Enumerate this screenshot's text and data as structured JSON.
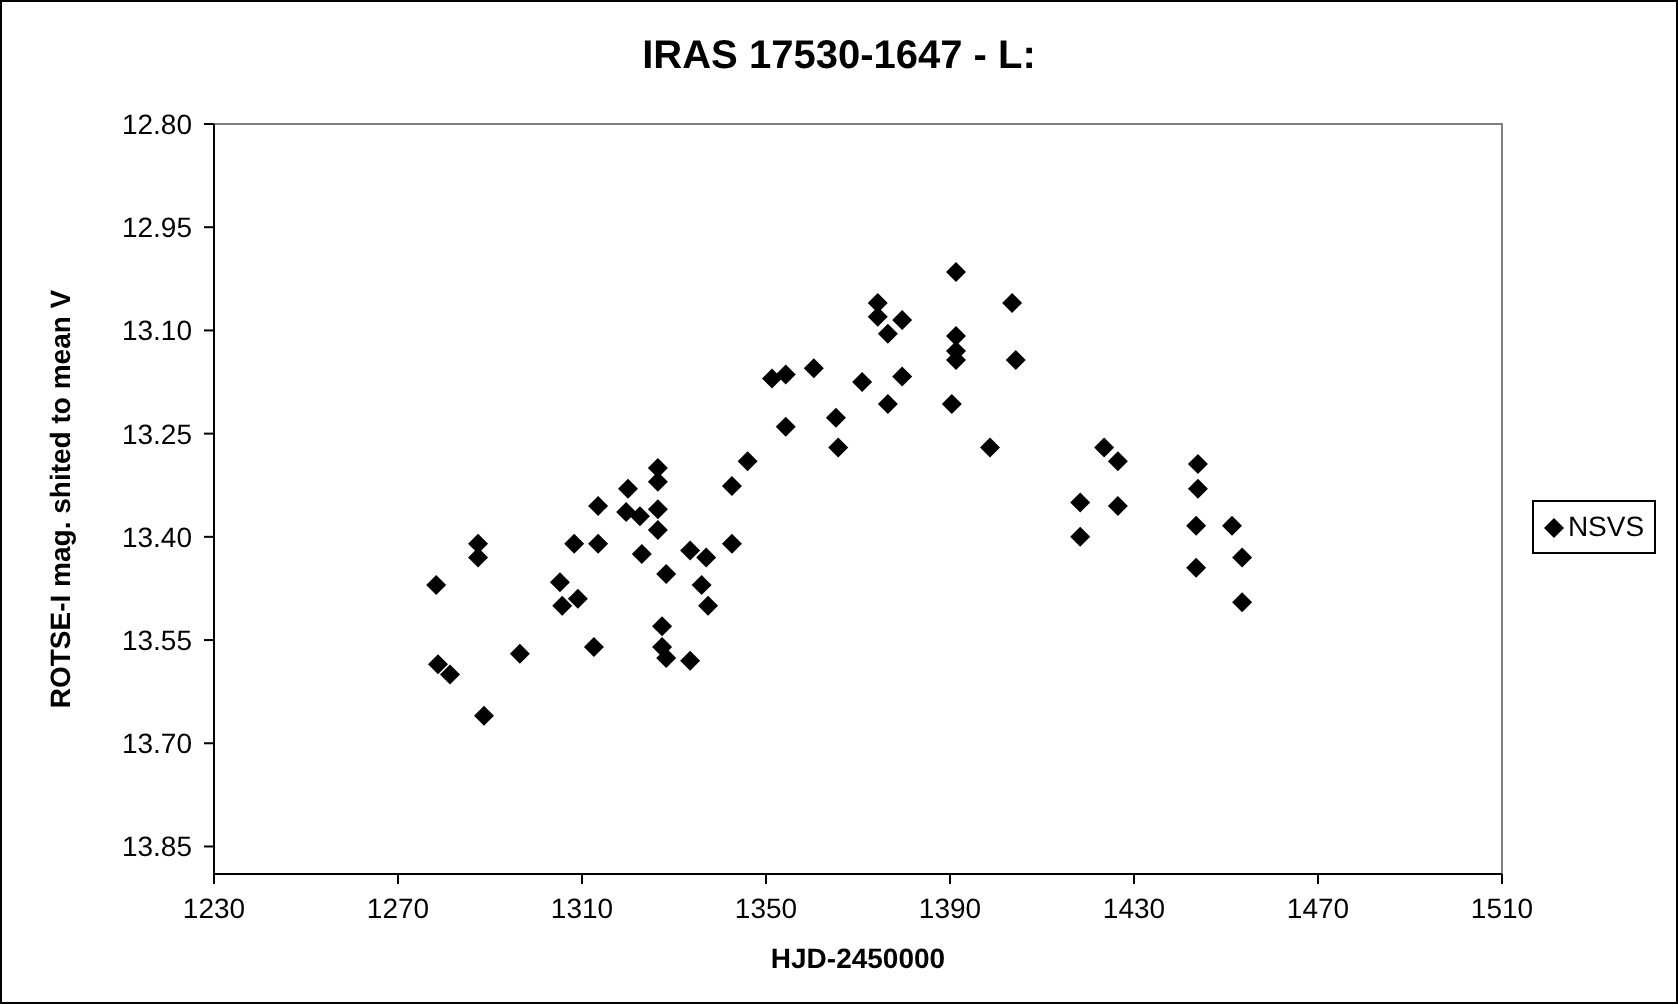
{
  "chart": {
    "title": "IRAS 17530-1647  - L:",
    "chart_data": {
      "type": "scatter",
      "xlabel": "HJD-2450000",
      "ylabel": "ROTSE-I mag. shited to mean V",
      "xlim": [
        1230,
        1510
      ],
      "ylim": [
        13.89,
        12.8
      ],
      "xticks": [
        1230,
        1270,
        1310,
        1350,
        1390,
        1430,
        1470,
        1510
      ],
      "yticks": [
        {
          "value": 12.8,
          "label": "12.80"
        },
        {
          "value": 12.95,
          "label": "12.95"
        },
        {
          "value": 13.1,
          "label": "13.10"
        },
        {
          "value": 13.25,
          "label": "13.25"
        },
        {
          "value": 13.4,
          "label": "13.40"
        },
        {
          "value": 13.55,
          "label": "13.55"
        },
        {
          "value": 13.7,
          "label": "13.70"
        },
        {
          "value": 13.85,
          "label": "13.85"
        }
      ],
      "series": [
        {
          "name": "NSVS",
          "color": "#000000",
          "x": [
            1278.3,
            1278.7,
            1281.3,
            1287.4,
            1287.4,
            1288.7,
            1296.5,
            1305.2,
            1305.7,
            1308.3,
            1309.1,
            1312.6,
            1313.5,
            1313.5,
            1319.6,
            1320,
            1322.6,
            1323,
            1326.5,
            1326.5,
            1326.5,
            1326.5,
            1327.4,
            1327.4,
            1328.3,
            1328.3,
            1333.5,
            1333.5,
            1337,
            1336,
            1337.4,
            1342.6,
            1342.6,
            1346,
            1351.3,
            1354.3,
            1354.3,
            1360.4,
            1365.2,
            1365.7,
            1370.9,
            1374.3,
            1374.3,
            1376.5,
            1376.5,
            1379.6,
            1379.6,
            1390.4,
            1391.3,
            1391.3,
            1391.3,
            1391.3,
            1398.7,
            1403.5,
            1404.3,
            1418.3,
            1418.3,
            1423.5,
            1426.5,
            1426.5,
            1443.5,
            1443.5,
            1443.9,
            1443.9,
            1451.3,
            1453.5,
            1453.5
          ],
          "values": [
            13.47,
            13.585,
            13.6,
            13.41,
            13.43,
            13.66,
            13.57,
            13.466,
            13.5,
            13.41,
            13.49,
            13.56,
            13.355,
            13.41,
            13.364,
            13.33,
            13.37,
            13.425,
            13.3,
            13.32,
            13.36,
            13.39,
            13.53,
            13.56,
            13.454,
            13.576,
            13.58,
            13.42,
            13.43,
            13.47,
            13.5,
            13.326,
            13.41,
            13.29,
            13.17,
            13.164,
            13.24,
            13.155,
            13.227,
            13.27,
            13.175,
            13.06,
            13.08,
            13.105,
            13.207,
            13.085,
            13.167,
            13.207,
            13.015,
            13.108,
            13.13,
            13.143,
            13.27,
            13.06,
            13.143,
            13.35,
            13.4,
            13.27,
            13.29,
            13.355,
            13.445,
            13.384,
            13.294,
            13.33,
            13.384,
            13.43,
            13.495
          ]
        }
      ]
    }
  }
}
